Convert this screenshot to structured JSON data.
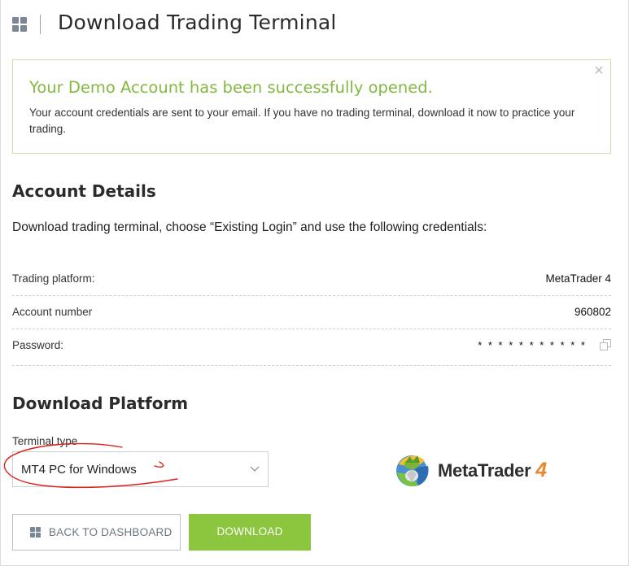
{
  "header": {
    "title": "Download Trading Terminal",
    "icon": "grid-icon"
  },
  "alert": {
    "title": "Your Demo Account has been successfully opened.",
    "text": "Your account credentials are sent to your email. If you have no trading terminal, download it now to practice your trading.",
    "close_glyph": "×",
    "accent_color": "#84b843"
  },
  "account": {
    "section_title": "Account Details",
    "instructions": "Download trading terminal, choose “Existing Login” and use the following credentials:",
    "rows": [
      {
        "label": "Trading platform:",
        "value": "MetaTrader 4"
      },
      {
        "label": "Account number",
        "value": "960802"
      },
      {
        "label": "Password:",
        "value": "* * * * * * * * * * *"
      }
    ]
  },
  "download": {
    "section_title": "Download Platform",
    "terminal_label": "Terminal type",
    "selected_terminal": "MT4 PC for Windows",
    "logo_text": "MetaTrader",
    "logo_number": "4",
    "logo_accent_color": "#e8872e"
  },
  "buttons": {
    "back_label": "BACK TO DASHBOARD",
    "download_label": "DOWNLOAD",
    "download_color": "#8cc63f"
  },
  "annotation": {
    "color": "#e0201b"
  }
}
